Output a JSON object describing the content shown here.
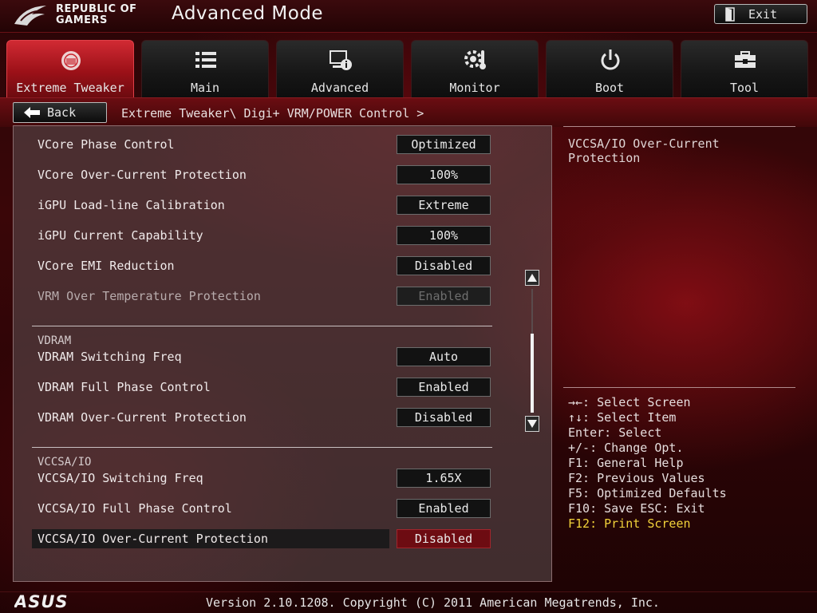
{
  "header": {
    "brand_line1": "REPUBLIC OF",
    "brand_line2": "GAMERS",
    "mode_title": "Advanced Mode",
    "exit_label": "Exit"
  },
  "tabs": [
    {
      "label": "Extreme Tweaker",
      "icon": "speedometer-icon",
      "active": true
    },
    {
      "label": "Main",
      "icon": "list-icon",
      "active": false
    },
    {
      "label": "Advanced",
      "icon": "info-display-icon",
      "active": false
    },
    {
      "label": "Monitor",
      "icon": "gear-thermometer-icon",
      "active": false
    },
    {
      "label": "Boot",
      "icon": "power-icon",
      "active": false
    },
    {
      "label": "Tool",
      "icon": "toolbox-icon",
      "active": false
    }
  ],
  "nav": {
    "back_label": "Back",
    "breadcrumb": "Extreme Tweaker\\ Digi+ VRM/POWER Control >"
  },
  "settings": {
    "rows": [
      {
        "label": "VCore Phase Control",
        "value": "Optimized"
      },
      {
        "label": "VCore Over-Current Protection",
        "value": "100%"
      },
      {
        "label": "iGPU Load-line Calibration",
        "value": "Extreme"
      },
      {
        "label": "iGPU Current Capability",
        "value": "100%"
      },
      {
        "label": "VCore EMI Reduction",
        "value": "Disabled"
      },
      {
        "label": "VRM Over Temperature Protection",
        "value": "Enabled",
        "disabled": true
      }
    ],
    "vdram_heading": "VDRAM",
    "vdram_rows": [
      {
        "label": "VDRAM Switching Freq",
        "value": "Auto"
      },
      {
        "label": "VDRAM Full Phase Control",
        "value": "Enabled"
      },
      {
        "label": "VDRAM Over-Current Protection",
        "value": "Disabled"
      }
    ],
    "vccsa_heading": "VCCSA/IO",
    "vccsa_rows": [
      {
        "label": "VCCSA/IO Switching Freq",
        "value": "1.65X"
      },
      {
        "label": "VCCSA/IO Full Phase Control",
        "value": "Enabled"
      },
      {
        "label": "VCCSA/IO Over-Current Protection",
        "value": "Disabled",
        "selected": true
      }
    ]
  },
  "help": {
    "description": "VCCSA/IO Over-Current Protection",
    "keys": [
      "→←: Select Screen",
      "↑↓: Select Item",
      "Enter: Select",
      "+/-: Change Opt.",
      "F1: General Help",
      "F2: Previous Values",
      "F5: Optimized Defaults",
      "F10: Save  ESC: Exit",
      "F12: Print Screen"
    ],
    "highlight_color": "#f2d33a"
  },
  "footer": {
    "brand": "ASUS",
    "version": "Version 2.10.1208. Copyright (C) 2011 American Megatrends, Inc."
  },
  "colors": {
    "accent": "#c8202a",
    "selected_value_bg": "#6d0c12"
  }
}
